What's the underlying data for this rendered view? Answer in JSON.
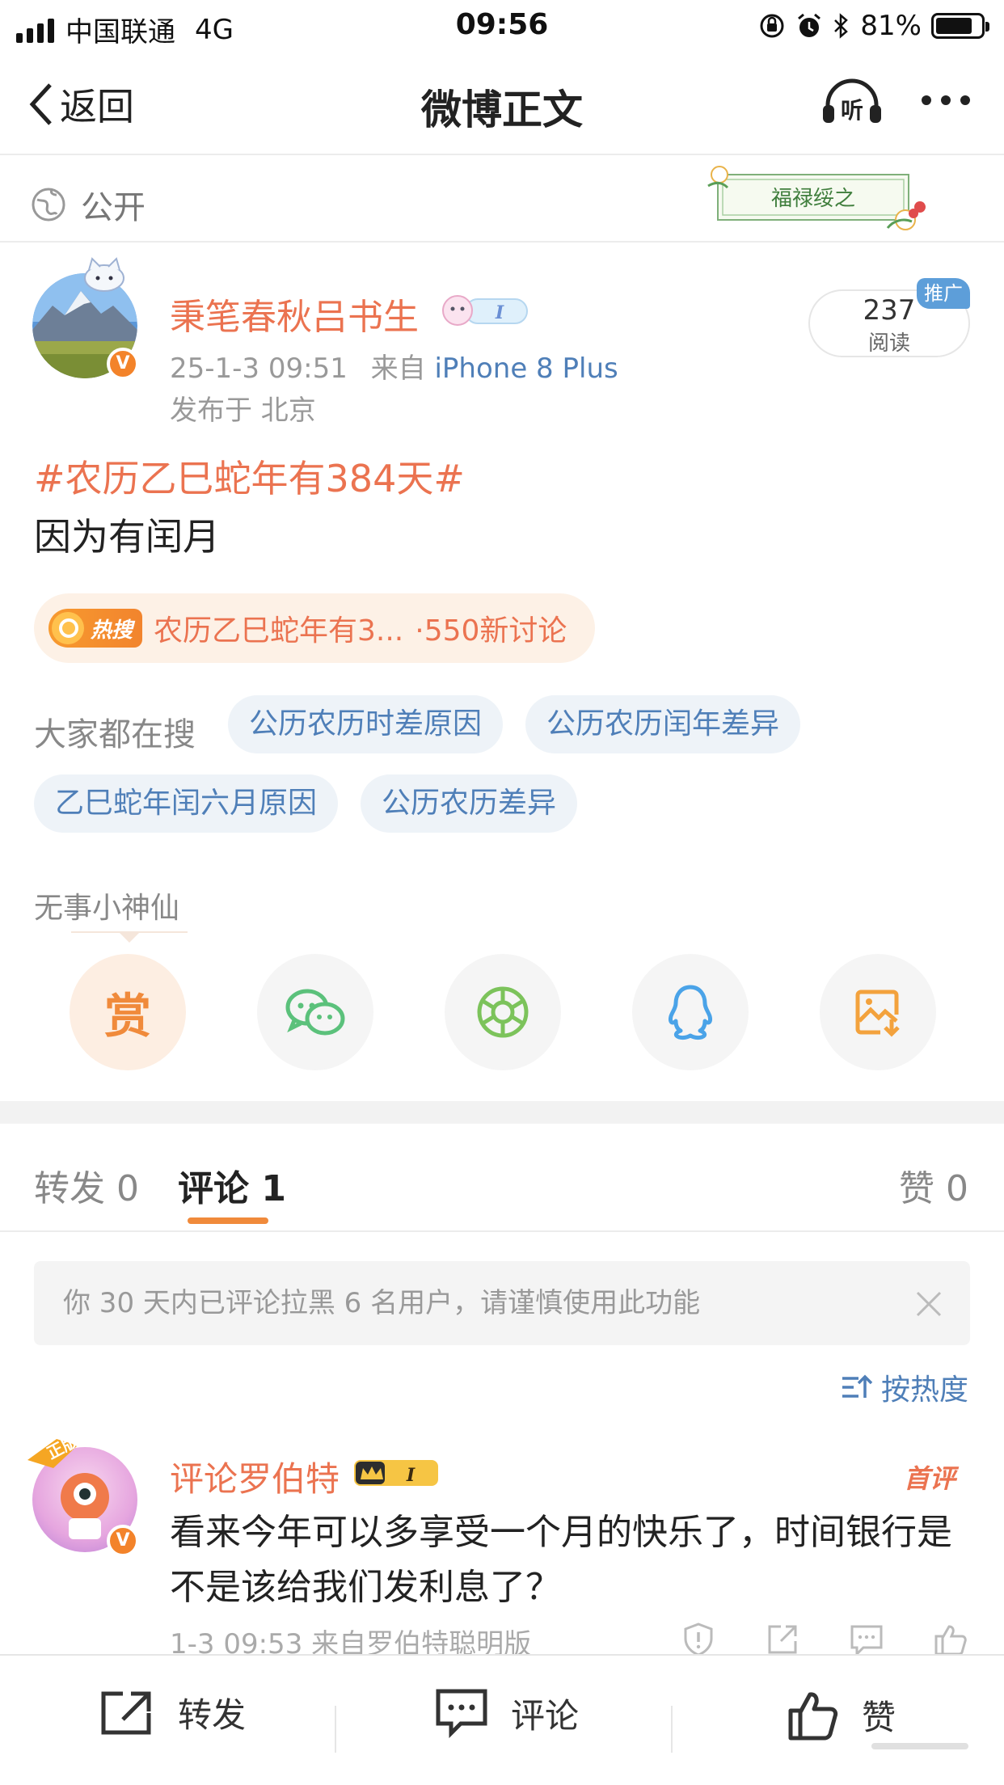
{
  "status_bar": {
    "carrier": "中国联通",
    "network": "4G",
    "time": "09:56",
    "battery": "81%",
    "battery_level": 0.81
  },
  "nav": {
    "back_label": "返回",
    "title": "微博正文",
    "listen_label": "听"
  },
  "visibility": {
    "label": "公开",
    "badge_text": "福禄绥之"
  },
  "post": {
    "author": "秉笔春秋吕书生",
    "date": "25-1-3 09:51",
    "source_prefix": "来自",
    "device": "iPhone 8 Plus",
    "location": "发布于 北京",
    "reads": "237",
    "reads_label": "阅读",
    "promo_tag": "推广",
    "topic": "#农历乙巳蛇年有384天#",
    "text": "因为有闰月"
  },
  "hot_search": {
    "tag": "热搜",
    "text": "农历乙巳蛇年有3...",
    "count": "·550新讨论"
  },
  "searching": {
    "label": "大家都在搜",
    "chips": [
      "公历农历时差原因",
      "公历农历闰年差异",
      "乙巳蛇年闰六月原因",
      "公历农历差异"
    ]
  },
  "reward": {
    "label": "无事小神仙",
    "reward_char": "赏"
  },
  "tabs": {
    "repost": "转发 0",
    "comment": "评论 1",
    "like": "赞 0"
  },
  "notice": {
    "text": "你 30 天内已评论拉黑 6 名用户，请谨慎使用此功能"
  },
  "sort": {
    "label": "按热度"
  },
  "comment": {
    "author": "评论罗伯特",
    "first_tag": "首评",
    "text": "看来今年可以多享受一个月的快乐了，时间银行是不是该给我们发利息了？",
    "meta": "1-3 09:53  来自罗伯特聪明版"
  },
  "bottom_bar": {
    "repost": "转发",
    "comment": "评论",
    "like": "赞"
  },
  "colors": {
    "accent_orange": "#eb7350",
    "link_blue": "#4f7fb8",
    "tab_underline": "#f08a3b",
    "wechat_green": "#5bc17b",
    "moments_green": "#7cc35b",
    "qq_blue": "#4aa3e8",
    "save_orange": "#f3a23d"
  }
}
